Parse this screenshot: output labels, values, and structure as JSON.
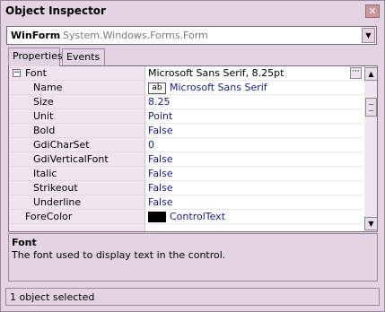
{
  "window": {
    "title": "Object Inspector",
    "close_glyph": "✕"
  },
  "object_selector": {
    "name": "WinForm",
    "type": "System.Windows.Forms.Form",
    "dropdown_glyph": "▼"
  },
  "tabs": [
    {
      "label": "Properties",
      "active": true
    },
    {
      "label": "Events",
      "active": false
    }
  ],
  "grid": {
    "expander_glyph": "−",
    "ellipsis_glyph": "···",
    "font_swatch_text": "ab",
    "rows": [
      {
        "name": "Font",
        "value": "Microsoft Sans Serif, 8.25pt",
        "selected": true
      },
      {
        "name": "Name",
        "value": "Microsoft Sans Serif"
      },
      {
        "name": "Size",
        "value": "8.25"
      },
      {
        "name": "Unit",
        "value": "Point"
      },
      {
        "name": "Bold",
        "value": "False"
      },
      {
        "name": "GdiCharSet",
        "value": "0"
      },
      {
        "name": "GdiVerticalFont",
        "value": "False"
      },
      {
        "name": "Italic",
        "value": "False"
      },
      {
        "name": "Strikeout",
        "value": "False"
      },
      {
        "name": "Underline",
        "value": "False"
      },
      {
        "name": "ForeColor",
        "value": "ControlText"
      }
    ],
    "forecolor_swatch": "#000000",
    "scroll_up_glyph": "▲",
    "scroll_down_glyph": "▼"
  },
  "description": {
    "title": "Font",
    "text": "The font used to display text in the control."
  },
  "status": {
    "text": "1 object selected"
  }
}
